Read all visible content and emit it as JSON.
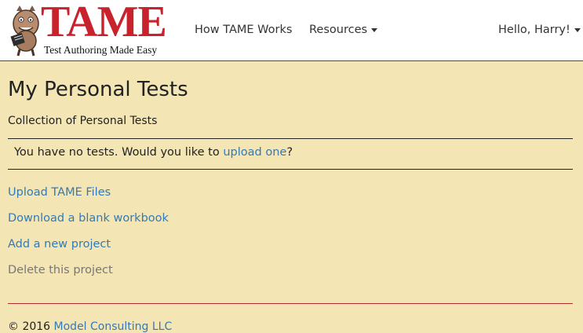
{
  "brand": {
    "name": "TAME",
    "tagline": "Test Authoring Made Easy",
    "mascot_icon": "monster-mascot-icon",
    "color": "#c8232c"
  },
  "nav": {
    "how_label": "How TAME Works",
    "resources_label": "Resources",
    "user_label": "Hello, Harry!"
  },
  "page": {
    "title": "My Personal Tests",
    "subtitle": "Collection of Personal Tests"
  },
  "notice": {
    "before": "You have no tests. Would you like to ",
    "link": "upload one",
    "after": "?"
  },
  "actions": [
    {
      "label": "Upload TAME Files",
      "enabled": true
    },
    {
      "label": "Download a blank workbook",
      "enabled": true
    },
    {
      "label": "Add a new project",
      "enabled": true
    },
    {
      "label": "Delete this project",
      "enabled": false
    }
  ],
  "footer": {
    "copyright": "© 2016 ",
    "company": "Model Consulting LLC"
  },
  "colors": {
    "background": "#f3e5b4",
    "link": "#337ab7",
    "disabled": "#777777",
    "divider": "#b03030"
  }
}
